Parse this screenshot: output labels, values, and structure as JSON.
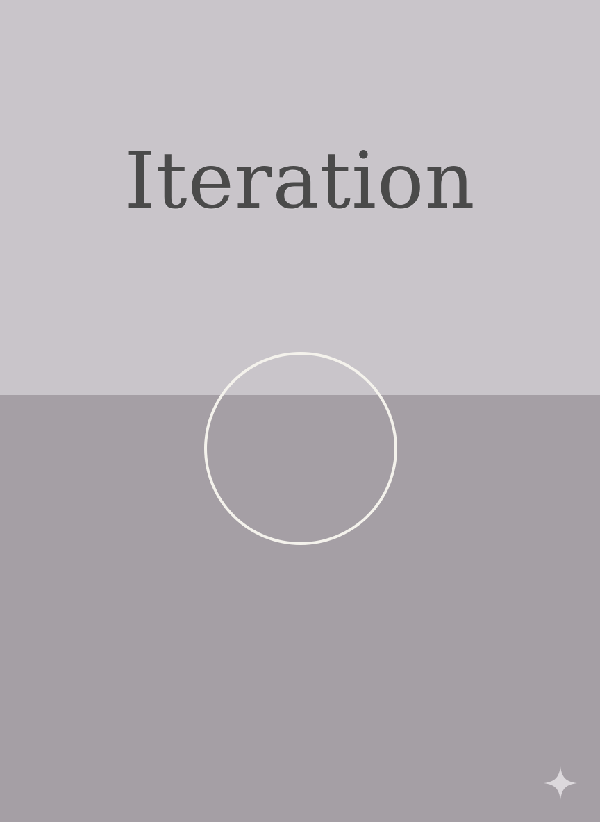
{
  "title": "Iteration",
  "icons": {
    "ring": "ring-outline",
    "sparkle": "sparkle-star-icon"
  },
  "colors": {
    "top_background": "#c9c5ca",
    "bottom_background": "#a59fa5",
    "title_text": "#4a4a4a",
    "ring_stroke": "#f4f2ec",
    "sparkle_fill": "#dcd8dc"
  }
}
